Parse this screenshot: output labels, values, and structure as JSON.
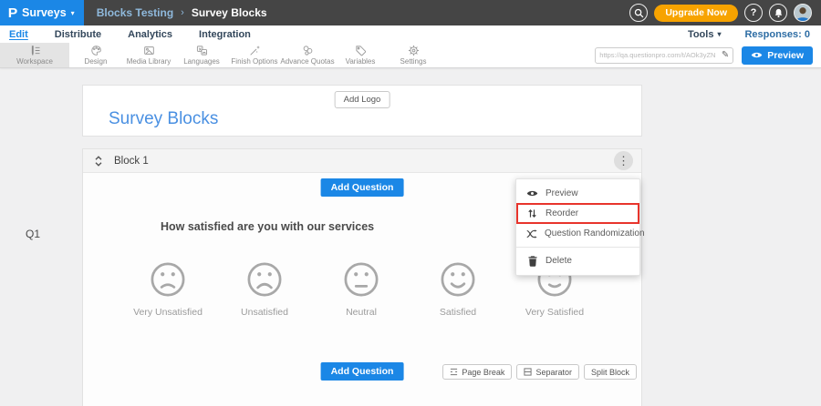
{
  "colors": {
    "accent_blue": "#1b87e6",
    "upgrade_orange": "#f7a300",
    "highlight_red": "#e8342c",
    "title_blue": "#4a90e2",
    "topbar_gray": "#454545"
  },
  "icons": {
    "caret_down": "▾",
    "dots_vertical": "⋮",
    "pencil": "✎"
  },
  "topbar": {
    "logo_letter": "P",
    "product_label": "Surveys",
    "breadcrumb": {
      "parent": "Blocks Testing",
      "separator": "›",
      "current": "Survey Blocks"
    },
    "upgrade_label": "Upgrade Now",
    "help_label": "?"
  },
  "nav": {
    "tabs": [
      {
        "label": "Edit",
        "active": true
      },
      {
        "label": "Distribute",
        "active": false
      },
      {
        "label": "Analytics",
        "active": false
      },
      {
        "label": "Integration",
        "active": false
      }
    ],
    "tools_label": "Tools",
    "responses_label": "Responses: 0"
  },
  "toolbar": {
    "tabs": [
      {
        "label": "Workspace",
        "icon": "workspace-icon",
        "active": true
      },
      {
        "label": "Design",
        "icon": "design-icon",
        "active": false
      },
      {
        "label": "Media Library",
        "icon": "media-library-icon",
        "active": false
      },
      {
        "label": "Languages",
        "icon": "languages-icon",
        "active": false
      },
      {
        "label": "Finish Options",
        "icon": "finish-options-icon",
        "active": false
      },
      {
        "label": "Advance Quotas",
        "icon": "advance-quotas-icon",
        "active": false
      },
      {
        "label": "Variables",
        "icon": "variables-icon",
        "active": false
      },
      {
        "label": "Settings",
        "icon": "settings-icon",
        "active": false
      }
    ],
    "survey_url": "https://qa.questionpro.com/t/AOk3yZN",
    "preview_label": "Preview"
  },
  "survey": {
    "add_logo_label": "Add Logo",
    "title": "Survey Blocks"
  },
  "block": {
    "name": "Block 1",
    "add_question_label": "Add Question",
    "question": {
      "code": "Q1",
      "text": "How satisfied are you with our services",
      "options": [
        {
          "label": "Very Unsatisfied",
          "mood": "frown"
        },
        {
          "label": "Unsatisfied",
          "mood": "frown-deep"
        },
        {
          "label": "Neutral",
          "mood": "neutral"
        },
        {
          "label": "Satisfied",
          "mood": "smile"
        },
        {
          "label": "Very Satisfied",
          "mood": "smile-small"
        }
      ]
    },
    "footer_actions": [
      "Page Break",
      "Separator",
      "Split Block"
    ]
  },
  "context_menu": {
    "items": [
      {
        "label": "Preview",
        "icon": "eye-icon",
        "highlighted": false
      },
      {
        "label": "Reorder",
        "icon": "reorder-icon",
        "highlighted": true
      },
      {
        "label": "Question Randomization",
        "icon": "shuffle-icon",
        "highlighted": false
      },
      {
        "label": "Delete",
        "icon": "trash-icon",
        "highlighted": false,
        "divider_before": true
      }
    ]
  }
}
